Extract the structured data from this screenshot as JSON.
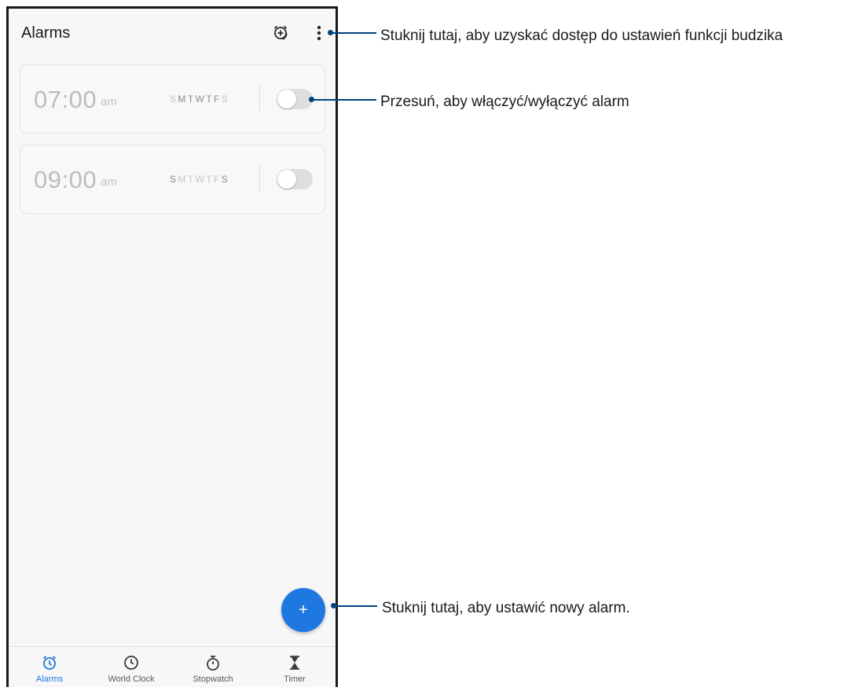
{
  "app": {
    "title": "Alarms"
  },
  "alarms": [
    {
      "time": "07:00",
      "ampm": "am",
      "days": [
        {
          "label": "S",
          "active": false
        },
        {
          "label": "M",
          "active": true
        },
        {
          "label": "T",
          "active": true
        },
        {
          "label": "W",
          "active": true
        },
        {
          "label": "T",
          "active": true
        },
        {
          "label": "F",
          "active": true
        },
        {
          "label": "S",
          "active": false
        }
      ],
      "enabled": false
    },
    {
      "time": "09:00",
      "ampm": "am",
      "days": [
        {
          "label": "S",
          "active": true
        },
        {
          "label": "M",
          "active": false
        },
        {
          "label": "T",
          "active": false
        },
        {
          "label": "W",
          "active": false
        },
        {
          "label": "T",
          "active": false
        },
        {
          "label": "F",
          "active": false
        },
        {
          "label": "S",
          "active": true
        }
      ],
      "enabled": false
    }
  ],
  "fab": {
    "icon": "plus-icon",
    "label": "+"
  },
  "bottom_nav": [
    {
      "label": "Alarms",
      "icon": "alarm-clock-icon",
      "active": true
    },
    {
      "label": "World Clock",
      "icon": "clock-icon",
      "active": false
    },
    {
      "label": "Stopwatch",
      "icon": "stopwatch-icon",
      "active": false
    },
    {
      "label": "Timer",
      "icon": "hourglass-icon",
      "active": false
    }
  ],
  "callouts": {
    "settings": "Stuknij tutaj, aby uzyskać dostęp do ustawień funkcji budzika",
    "toggle": "Przesuń, aby włączyć/wyłączyć alarm",
    "new_alarm": "Stuknij tutaj, aby ustawić nowy alarm."
  },
  "colors": {
    "accent": "#1f77e0",
    "callout_line": "#00427a",
    "background": "#f7f7f7"
  }
}
